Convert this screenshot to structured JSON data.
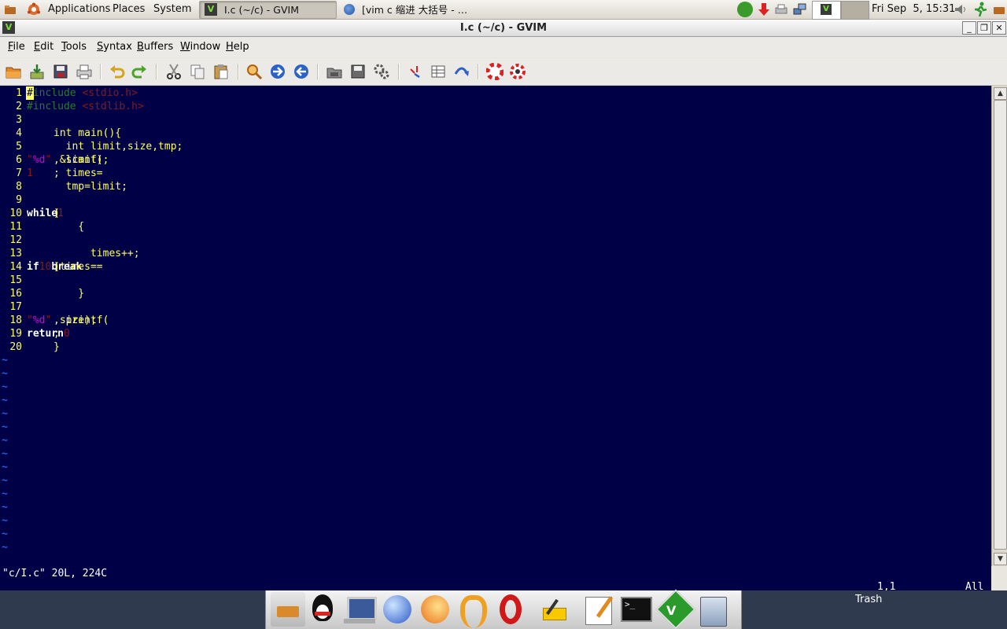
{
  "top_panel": {
    "applications_label": "Applications",
    "places_label": "Places",
    "system_label": "System",
    "tasks": [
      {
        "label": "I.c (~/c) - GVIM"
      },
      {
        "label": "[vim c 缩进 大括号 - …"
      }
    ],
    "clock": "Fri Sep  5, 15:31"
  },
  "window": {
    "title": "I.c (~/c) - GVIM"
  },
  "menubar": {
    "items": [
      {
        "label": "File",
        "underline": "F",
        "rest": "ile"
      },
      {
        "label": "Edit",
        "underline": "E",
        "rest": "dit"
      },
      {
        "label": "Tools",
        "underline": "T",
        "rest": "ools"
      },
      {
        "label": "Syntax",
        "underline": "S",
        "rest": "yntax"
      },
      {
        "label": "Buffers",
        "underline": "B",
        "rest": "uffers"
      },
      {
        "label": "Window",
        "underline": "W",
        "rest": "indow"
      },
      {
        "label": "Help",
        "underline": "H",
        "rest": "elp"
      }
    ]
  },
  "toolbar": {
    "icons": [
      "open-icon",
      "save-icon",
      "save-all-icon",
      "print-icon",
      "undo-icon",
      "redo-icon",
      "cut-icon",
      "copy-icon",
      "paste-icon",
      "find-replace-icon",
      "find-next-icon",
      "find-prev-icon",
      "load-session-icon",
      "save-session-icon",
      "run-script-icon",
      "make-icon",
      "run-ctags-icon",
      "jump-tag-icon",
      "help-icon",
      "find-help-icon"
    ]
  },
  "editor": {
    "lines": [
      {
        "n": "1",
        "segs": [
          {
            "t": "#",
            "c": "cursor"
          },
          {
            "t": "include ",
            "c": "pre"
          },
          {
            "t": "<stdio.h>",
            "c": "str"
          }
        ]
      },
      {
        "n": "2",
        "segs": [
          {
            "t": "#include ",
            "c": "pre"
          },
          {
            "t": "<stdlib.h>",
            "c": "str"
          }
        ]
      },
      {
        "n": "3",
        "segs": []
      },
      {
        "n": "4",
        "segs": [
          {
            "t": "int main(){",
            "c": "txt"
          }
        ]
      },
      {
        "n": "5",
        "segs": [
          {
            "t": "  int limit,size,tmp;",
            "c": "txt"
          }
        ]
      },
      {
        "n": "6",
        "segs": [
          {
            "t": "  scanf(",
            "c": "txt"
          },
          {
            "t": "\"",
            "c": "str"
          },
          {
            "t": "%d",
            "c": "spec"
          },
          {
            "t": "\"",
            "c": "str"
          },
          {
            "t": ",&limit);",
            "c": "txt"
          }
        ]
      },
      {
        "n": "7",
        "segs": [
          {
            "t": "  times=",
            "c": "txt"
          },
          {
            "t": "1",
            "c": "num"
          },
          {
            "t": ";",
            "c": "txt"
          }
        ]
      },
      {
        "n": "8",
        "segs": [
          {
            "t": "  tmp=limit;",
            "c": "txt"
          }
        ]
      },
      {
        "n": "9",
        "segs": []
      },
      {
        "n": "10",
        "segs": [
          {
            "t": "  ",
            "c": "txt"
          },
          {
            "t": "while",
            "c": "kw"
          },
          {
            "t": "(",
            "c": "txt"
          },
          {
            "t": "1",
            "c": "num"
          },
          {
            "t": ")",
            "c": "txt"
          }
        ]
      },
      {
        "n": "11",
        "segs": [
          {
            "t": "    {",
            "c": "txt"
          }
        ]
      },
      {
        "n": "12",
        "segs": []
      },
      {
        "n": "13",
        "segs": [
          {
            "t": "      times++;",
            "c": "txt"
          }
        ]
      },
      {
        "n": "14",
        "segs": [
          {
            "t": "      ",
            "c": "txt"
          },
          {
            "t": "if",
            "c": "kw"
          },
          {
            "t": "(times==",
            "c": "txt"
          },
          {
            "t": "10",
            "c": "num"
          },
          {
            "t": ")",
            "c": "txt"
          },
          {
            "t": "break",
            "c": "kw"
          },
          {
            "t": ";",
            "c": "txt"
          }
        ]
      },
      {
        "n": "15",
        "segs": []
      },
      {
        "n": "16",
        "segs": [
          {
            "t": "    }",
            "c": "txt"
          }
        ]
      },
      {
        "n": "17",
        "segs": []
      },
      {
        "n": "18",
        "segs": [
          {
            "t": "  printf(",
            "c": "txt"
          },
          {
            "t": "\"",
            "c": "str"
          },
          {
            "t": "%d",
            "c": "spec"
          },
          {
            "t": "\"",
            "c": "str"
          },
          {
            "t": ",size);",
            "c": "txt"
          }
        ]
      },
      {
        "n": "19",
        "segs": [
          {
            "t": "  ",
            "c": "txt"
          },
          {
            "t": "return",
            "c": "kw"
          },
          {
            "t": " ",
            "c": "txt"
          },
          {
            "t": "0",
            "c": "num"
          },
          {
            "t": ";",
            "c": "txt"
          }
        ]
      },
      {
        "n": "20",
        "segs": [
          {
            "t": "}",
            "c": "txt"
          }
        ]
      }
    ],
    "tilde": "~",
    "status_message": "\"c/I.c\" 20L, 224C",
    "ruler_position": "1,1",
    "ruler_percent": "All"
  },
  "dock": {
    "icons": [
      "file-manager-icon",
      "qq-penguin-icon",
      "computer-icon",
      "globe-browser-icon",
      "firefox-icon",
      "worm-icon",
      "opera-icon",
      "note-pad-icon",
      "text-editor-icon",
      "terminal-icon",
      "vim-icon",
      "trash-icon"
    ],
    "trash_label": "Trash"
  },
  "colors": {
    "editor_bg": "#000046",
    "text": "#ffff60",
    "keyword": "#ffffff",
    "preproc": "#2d7a2d",
    "string": "#8a1a1a",
    "special": "#d000d0",
    "tilde": "#2060e0",
    "panel_bottom": "#2f3a4e"
  }
}
